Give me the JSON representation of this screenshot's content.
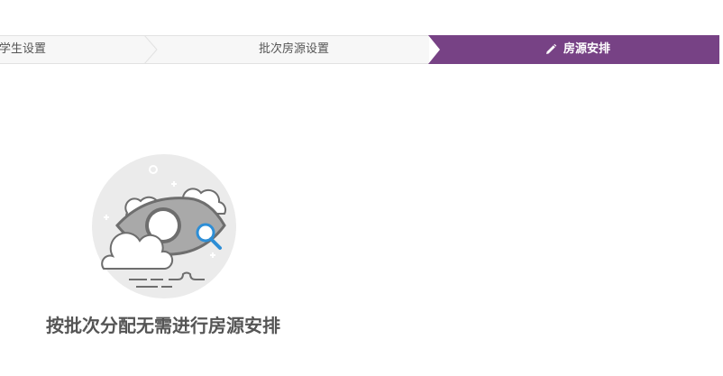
{
  "steps": [
    {
      "label": "学生设置",
      "state": "done"
    },
    {
      "label": "批次房源设置",
      "state": "done"
    },
    {
      "label": "房源安排",
      "state": "active",
      "icon": "pencil-icon"
    }
  ],
  "colors": {
    "active_step": "#774285",
    "inactive_step": "#f7f7f7",
    "text": "#555555",
    "icon_accent": "#2d8ed6"
  },
  "empty_state": {
    "icon": "eye-search-illustration",
    "message": "按批次分配无需进行房源安排"
  }
}
